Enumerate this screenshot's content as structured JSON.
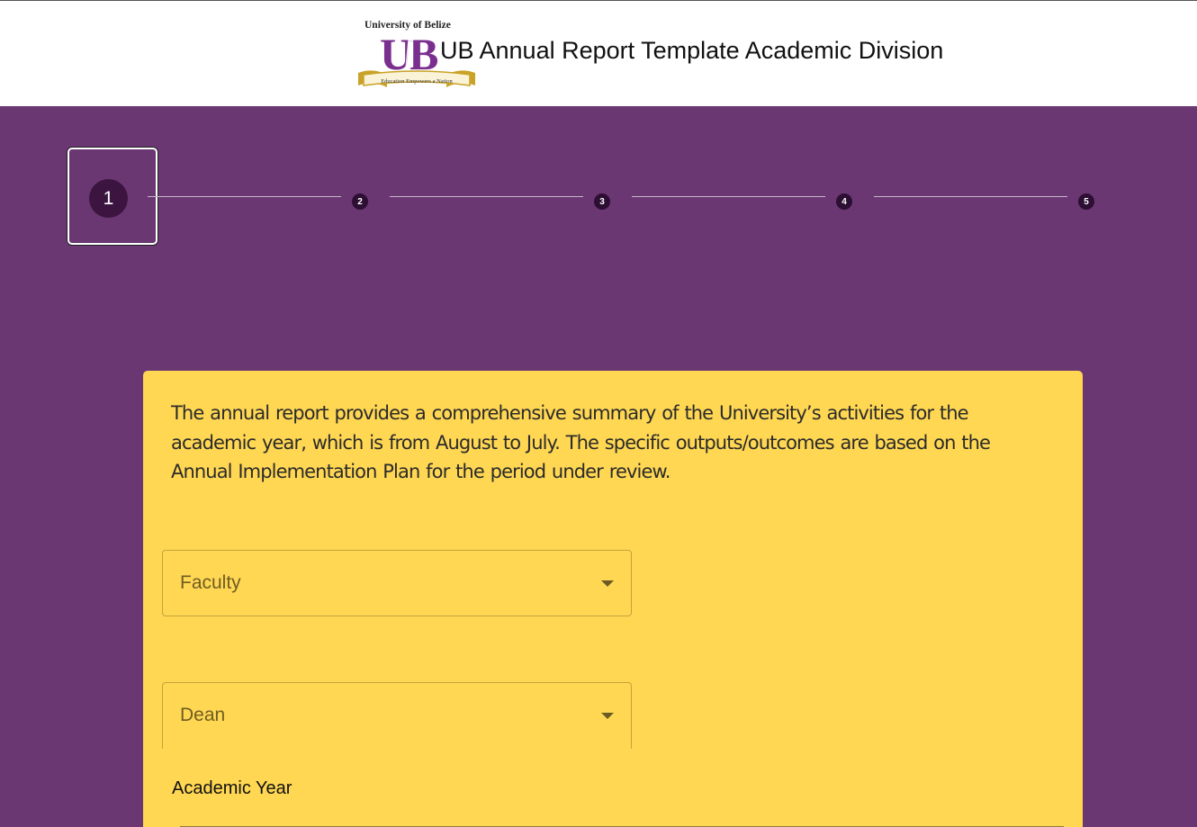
{
  "header": {
    "logo": {
      "top_text": "University of Belize",
      "monogram": "UB",
      "ribbon_text": "Education Empowers a Nation"
    },
    "title": "UB Annual Report Template Academic Division"
  },
  "stepper": {
    "active_step": 1,
    "steps": [
      "1",
      "2",
      "3",
      "4",
      "5"
    ]
  },
  "form": {
    "intro": "The annual report provides a comprehensive summary of the University’s activities for the academic year, which is from August to July. The specific outputs/outcomes are based on the Annual Implementation Plan for the period under review.",
    "faculty_select": {
      "label": "Faculty"
    },
    "dean_select": {
      "label": "Dean"
    },
    "academic_year": {
      "label": "Academic Year"
    }
  },
  "colors": {
    "background": "#6a3773",
    "card": "#ffd753",
    "step_circle": "#3b1540",
    "logo_purple": "#7a2f8f",
    "logo_gold": "#c9a227"
  }
}
